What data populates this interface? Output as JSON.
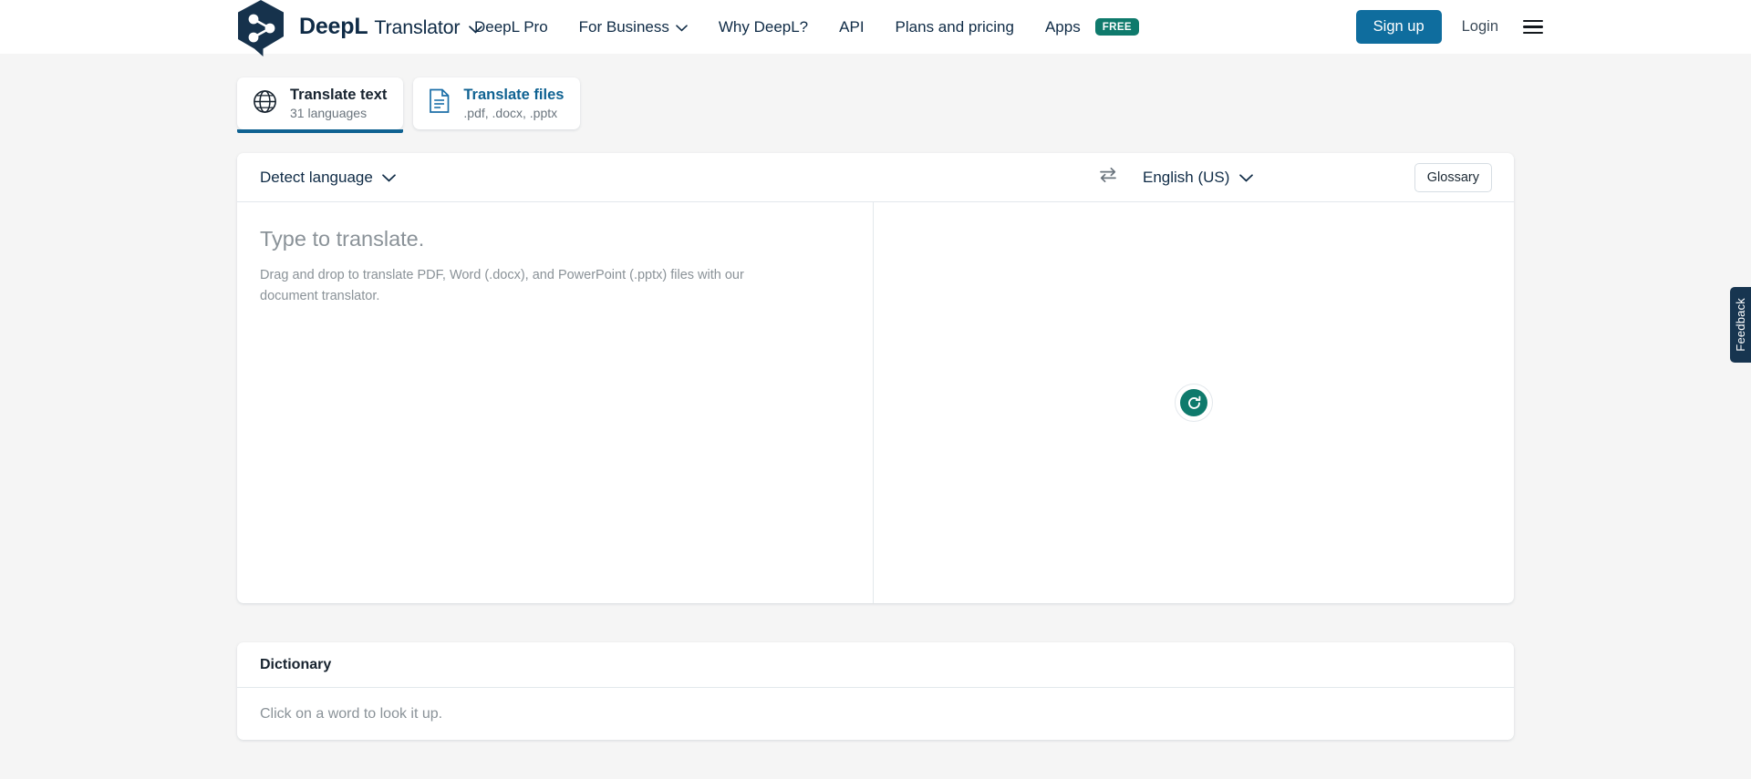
{
  "brand": {
    "name": "DeepL",
    "product": "Translator",
    "logo_icon": "deepl-hexagon-logo",
    "colors": {
      "navy": "#0f2b46",
      "blue": "#0f6d9e",
      "tab_underline": "#0f6292",
      "teal": "#0f7a6c",
      "page_bg": "#f5f5f5"
    }
  },
  "header": {
    "nav": [
      {
        "label": "DeepL Pro",
        "has_caret": false,
        "badge": ""
      },
      {
        "label": "For Business",
        "has_caret": true,
        "badge": ""
      },
      {
        "label": "Why DeepL?",
        "has_caret": false,
        "badge": ""
      },
      {
        "label": "API",
        "has_caret": false,
        "badge": ""
      },
      {
        "label": "Plans and pricing",
        "has_caret": false,
        "badge": ""
      },
      {
        "label": "Apps",
        "has_caret": false,
        "badge": "FREE"
      }
    ],
    "signup_label": "Sign up",
    "login_label": "Login",
    "menu_icon": "hamburger-menu-icon"
  },
  "tabs": [
    {
      "title": "Translate text",
      "subtitle": "31 languages",
      "icon": "globe-icon",
      "active": true
    },
    {
      "title": "Translate files",
      "subtitle": ".pdf, .docx, .pptx",
      "icon": "document-icon",
      "active": false
    }
  ],
  "translator": {
    "source_language": "Detect language",
    "target_language": "English (US)",
    "swap_icon": "swap-arrows-icon",
    "glossary_label": "Glossary",
    "input_placeholder": "Type to translate.",
    "input_hint": "Drag and drop to translate PDF, Word (.docx), and PowerPoint (.pptx) files with our document translator.",
    "output_status_icon": "loading-refresh-icon"
  },
  "dictionary": {
    "title": "Dictionary",
    "empty_text": "Click on a word to look it up."
  },
  "feedback": {
    "label": "Feedback"
  }
}
